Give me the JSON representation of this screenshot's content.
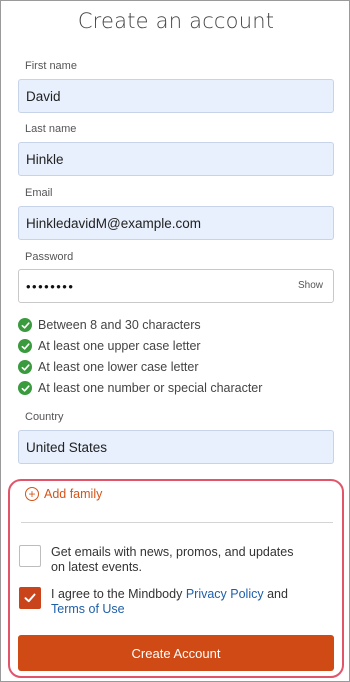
{
  "page": {
    "title": "Create an account"
  },
  "form": {
    "first_name": {
      "label": "First name",
      "value": "David"
    },
    "last_name": {
      "label": "Last name",
      "value": "Hinkle"
    },
    "email": {
      "label": "Email",
      "value": "HinkledavidM@example.com"
    },
    "password": {
      "label": "Password",
      "value": "••••••••",
      "show_label": "Show"
    },
    "requirements": [
      {
        "text": "Between 8 and 30 characters",
        "met": true
      },
      {
        "text": "At least one upper case letter",
        "met": true
      },
      {
        "text": "At least one lower case letter",
        "met": true
      },
      {
        "text": "At least one number or special character",
        "met": true
      }
    ],
    "country": {
      "label": "Country",
      "value": "United States"
    }
  },
  "family": {
    "add_label": "Add family"
  },
  "consents": {
    "marketing": {
      "text": "Get emails with news, promos, and updates on latest events.",
      "checked": false
    },
    "terms": {
      "prefix": "I agree to the Mindbody ",
      "privacy_link": "Privacy Policy",
      "middle": " and",
      "terms_link": "Terms of Use",
      "checked": true
    }
  },
  "cta": {
    "label": "Create Account"
  },
  "colors": {
    "accent": "#cf4a15",
    "autofill_bg": "#e8f0fd",
    "success": "#3a9a3e",
    "highlight_border": "#e0556a",
    "link": "#1f5fa8"
  }
}
